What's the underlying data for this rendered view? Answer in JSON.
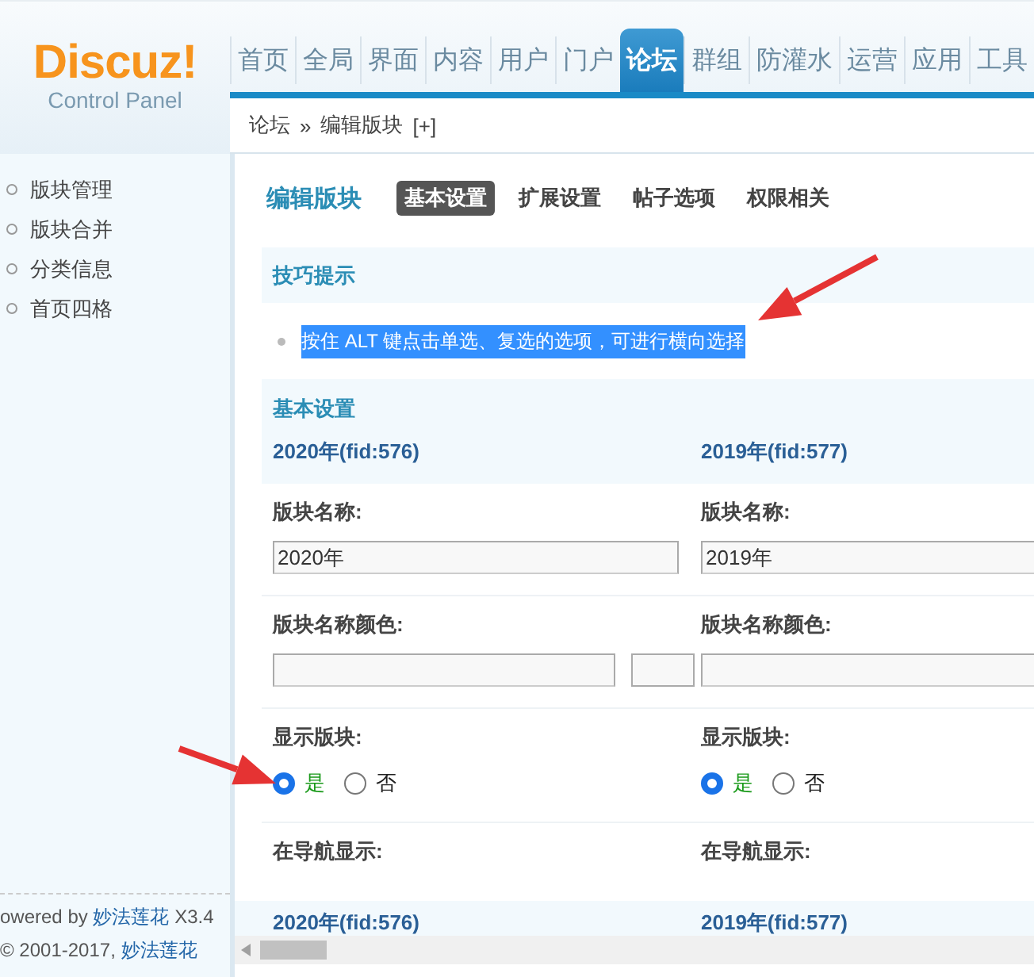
{
  "logo": {
    "name": "Discuz!",
    "subtitle": "Control Panel"
  },
  "nav": [
    {
      "label": "首页",
      "selected": false
    },
    {
      "label": "全局",
      "selected": false
    },
    {
      "label": "界面",
      "selected": false
    },
    {
      "label": "内容",
      "selected": false
    },
    {
      "label": "用户",
      "selected": false
    },
    {
      "label": "门户",
      "selected": false
    },
    {
      "label": "论坛",
      "selected": true
    },
    {
      "label": "群组",
      "selected": false
    },
    {
      "label": "防灌水",
      "selected": false
    },
    {
      "label": "运营",
      "selected": false
    },
    {
      "label": "应用",
      "selected": false
    },
    {
      "label": "工具",
      "selected": false
    }
  ],
  "breadcrumb": {
    "items": [
      "论坛",
      "编辑版块"
    ],
    "separator": "»",
    "toggle": "[+]"
  },
  "sidebar": {
    "items": [
      "版块管理",
      "版块合并",
      "分类信息",
      "首页四格"
    ],
    "footer": {
      "powered": "owered by",
      "powered_link": "妙法莲花",
      "version": "X3.4",
      "copyright": "© 2001-2017,",
      "copyright_link": "妙法莲花"
    }
  },
  "page_title": "编辑版块",
  "tabs": [
    {
      "label": "基本设置",
      "selected": true
    },
    {
      "label": "扩展设置",
      "selected": false
    },
    {
      "label": "帖子选项",
      "selected": false
    },
    {
      "label": "权限相关",
      "selected": false
    }
  ],
  "tip": {
    "title": "技巧提示",
    "text": "按住 ALT 键点击单选、复选的选项，可进行横向选择",
    "highlighted": true
  },
  "section_title": "基本设置",
  "forums": [
    "2020年(fid:576)",
    "2019年(fid:577)"
  ],
  "rows": [
    {
      "kind": "text",
      "cells": [
        {
          "label": "版块名称:",
          "value": "2020年"
        },
        {
          "label": "版块名称:",
          "value": "2019年"
        }
      ]
    },
    {
      "kind": "color",
      "cells": [
        {
          "label": "版块名称颜色:"
        },
        {
          "label": "版块名称颜色:"
        }
      ]
    },
    {
      "kind": "radio",
      "cells": [
        {
          "label": "显示版块:",
          "options": [
            {
              "label": "是",
              "selected": true
            },
            {
              "label": "否",
              "selected": false
            }
          ]
        },
        {
          "label": "显示版块:",
          "options": [
            {
              "label": "是",
              "selected": true
            },
            {
              "label": "否",
              "selected": false
            }
          ]
        }
      ]
    },
    {
      "kind": "radio",
      "cells": [
        {
          "label": "在导航显示:"
        },
        {
          "label": "在导航显示:"
        }
      ]
    }
  ],
  "footer_row": [
    "2020年(fid:576)",
    "2019年(fid:577)"
  ]
}
